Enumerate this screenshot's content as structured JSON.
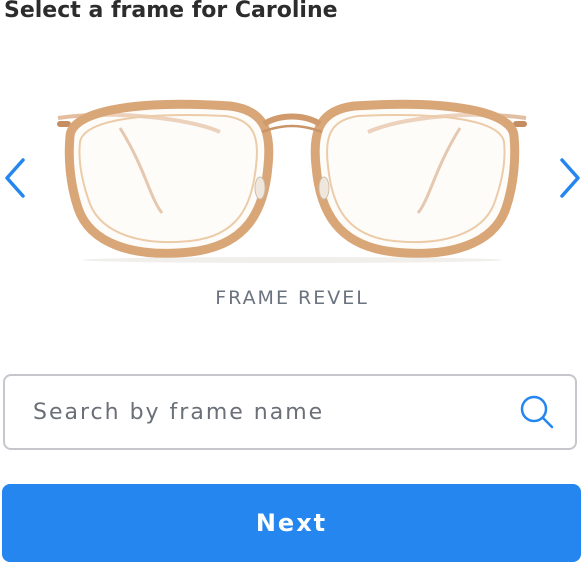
{
  "header": {
    "title": "Select a frame for Caroline"
  },
  "carousel": {
    "current_frame_name": "FRAME REVEL",
    "prev_icon": "chevron-left-icon",
    "next_icon": "chevron-right-icon",
    "arrow_color": "#2486ee"
  },
  "search": {
    "placeholder": "Search by frame name",
    "value": "",
    "icon": "search-icon"
  },
  "actions": {
    "next_label": "Next"
  },
  "colors": {
    "primary": "#2486ee",
    "title_text": "#2c2c2c",
    "muted_text": "#6b7380"
  }
}
